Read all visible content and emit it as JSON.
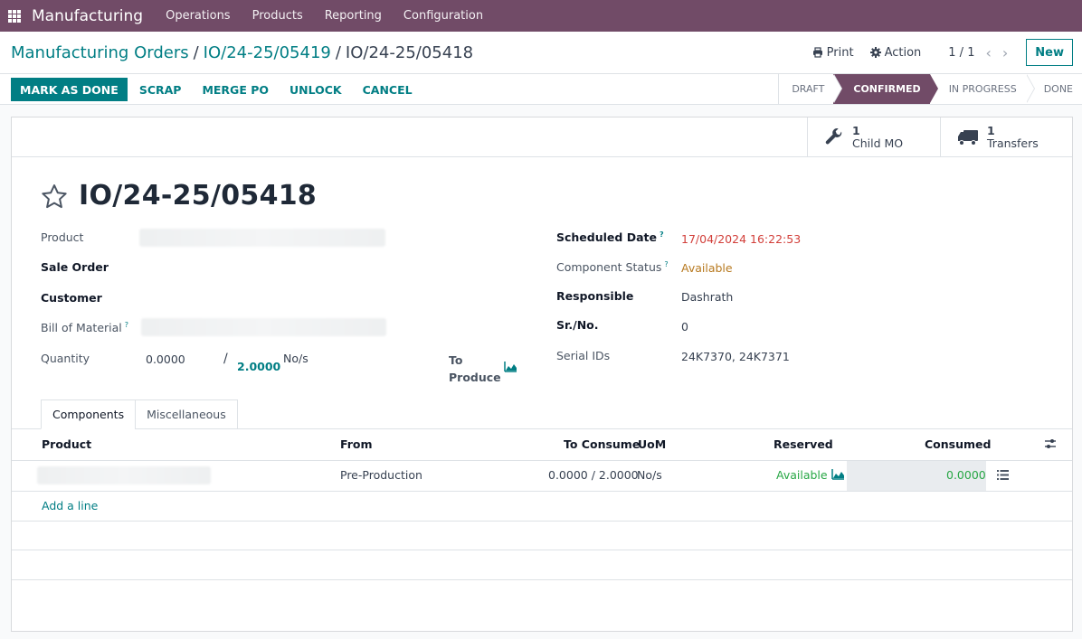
{
  "navbar": {
    "app_name": "Manufacturing",
    "menu": [
      "Operations",
      "Products",
      "Reporting",
      "Configuration"
    ]
  },
  "breadcrumb": {
    "root": "Manufacturing Orders",
    "parent": "IO/24-25/05419",
    "current": "IO/24-25/05418",
    "separator": "/"
  },
  "control": {
    "print_label": "Print",
    "action_label": "Action",
    "pager": "1 / 1",
    "new_label": "New"
  },
  "actions": {
    "mark_done": "MARK AS DONE",
    "scrap": "SCRAP",
    "merge_po": "MERGE PO",
    "unlock": "UNLOCK",
    "cancel": "CANCEL"
  },
  "stages": {
    "items": [
      "DRAFT",
      "CONFIRMED",
      "IN PROGRESS",
      "DONE"
    ],
    "active": "CONFIRMED"
  },
  "smart_buttons": {
    "child_mo": {
      "count": "1",
      "label": "Child MO"
    },
    "transfers": {
      "count": "1",
      "label": "Transfers"
    }
  },
  "record": {
    "name": "IO/24-25/05418"
  },
  "fields_left": {
    "product_label": "Product",
    "sale_order_label": "Sale Order",
    "customer_label": "Customer",
    "bom_label": "Bill of Material",
    "quantity_label": "Quantity",
    "quantity_produced": "0.0000",
    "quantity_sep": "/",
    "quantity_total": "2.0000",
    "quantity_uom": "No/s",
    "to_produce_line1": "To",
    "to_produce_line2": "Produce",
    "help_mark": "?"
  },
  "fields_right": {
    "scheduled_date_label": "Scheduled Date",
    "scheduled_date": "17/04/2024 16:22:53",
    "component_status_label": "Component Status",
    "component_status": "Available",
    "responsible_label": "Responsible",
    "responsible": "Dashrath",
    "srno_label": "Sr./No.",
    "srno": "0",
    "serial_ids_label": "Serial IDs",
    "serial_ids": "24K7370, 24K7371",
    "help_mark": "?"
  },
  "tabs": [
    "Components",
    "Miscellaneous"
  ],
  "components_table": {
    "headers": {
      "product": "Product",
      "from": "From",
      "to_consume": "To Consume",
      "uom": "UoM",
      "reserved": "Reserved",
      "consumed": "Consumed"
    },
    "rows": [
      {
        "from": "Pre-Production",
        "to_consume": "0.0000 / 2.0000",
        "uom": "No/s",
        "reserved": "Available",
        "consumed": "0.0000"
      }
    ],
    "add_line": "Add a line"
  },
  "colors": {
    "brand": "#714B67",
    "accent": "#017e84",
    "danger": "#d23f3a",
    "warning": "#b7791f",
    "success": "#28a745"
  },
  "icons": [
    "apps-grid-icon",
    "printer-icon",
    "gear-icon",
    "chevron-left-icon",
    "chevron-right-icon",
    "wrench-icon",
    "truck-icon",
    "star-icon",
    "area-chart-icon",
    "column-settings-icon",
    "list-icon"
  ]
}
